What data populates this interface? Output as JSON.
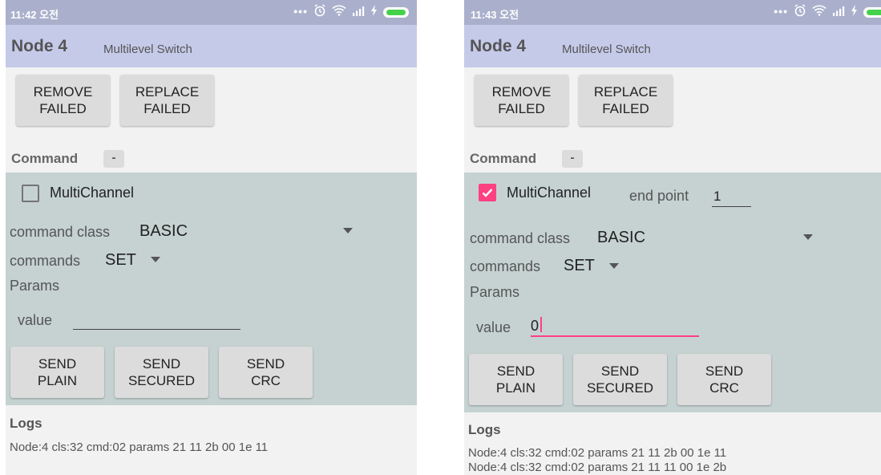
{
  "screens": [
    {
      "status_time": "11:42 오전",
      "title": "Node 4",
      "subtitle": "Multilevel Switch",
      "buttons": {
        "remove_failed": "REMOVE\nFAILED",
        "replace_failed": "REPLACE\nFAILED"
      },
      "command_label": "Command",
      "command_toggle": "-",
      "multichannel": {
        "label": "MultiChannel",
        "checked": false
      },
      "command_class": {
        "label": "command class",
        "value": "BASIC"
      },
      "commands": {
        "label": "commands",
        "value": "SET"
      },
      "params_label": "Params",
      "value_field": {
        "label": "value",
        "value": ""
      },
      "send_buttons": {
        "plain": "SEND\nPLAIN",
        "secured": "SEND\nSECURED",
        "crc": "SEND\nCRC"
      },
      "logs_title": "Logs",
      "logs": [
        "Node:4 cls:32 cmd:02 params 21 11 2b 00 1e 11"
      ]
    },
    {
      "status_time": "11:43 오전",
      "title": "Node 4",
      "subtitle": "Multilevel Switch",
      "buttons": {
        "remove_failed": "REMOVE\nFAILED",
        "replace_failed": "REPLACE\nFAILED"
      },
      "command_label": "Command",
      "command_toggle": "-",
      "multichannel": {
        "label": "MultiChannel",
        "checked": true
      },
      "end_point": {
        "label": "end point",
        "value": "1"
      },
      "command_class": {
        "label": "command class",
        "value": "BASIC"
      },
      "commands": {
        "label": "commands",
        "value": "SET"
      },
      "params_label": "Params",
      "value_field": {
        "label": "value",
        "value": "0"
      },
      "send_buttons": {
        "plain": "SEND\nPLAIN",
        "secured": "SEND\nSECURED",
        "crc": "SEND\nCRC"
      },
      "logs_title": "Logs",
      "logs": [
        "Node:4 cls:32 cmd:02 params 21 11 2b 00 1e 11",
        "Node:4 cls:32 cmd:02 params 21 11 11 00 1e 2b"
      ]
    }
  ],
  "colors": {
    "status_bar": "#aab0cc",
    "app_bar": "#c5cae9",
    "panel": "#c5d2d1",
    "accent": "#ff4081",
    "button": "#dcdcdc"
  },
  "icons": [
    "more-dots-icon",
    "alarm-icon",
    "wifi-icon",
    "signal-icon",
    "charging-icon",
    "battery-icon",
    "dropdown-arrow-icon",
    "checkmark-icon"
  ]
}
